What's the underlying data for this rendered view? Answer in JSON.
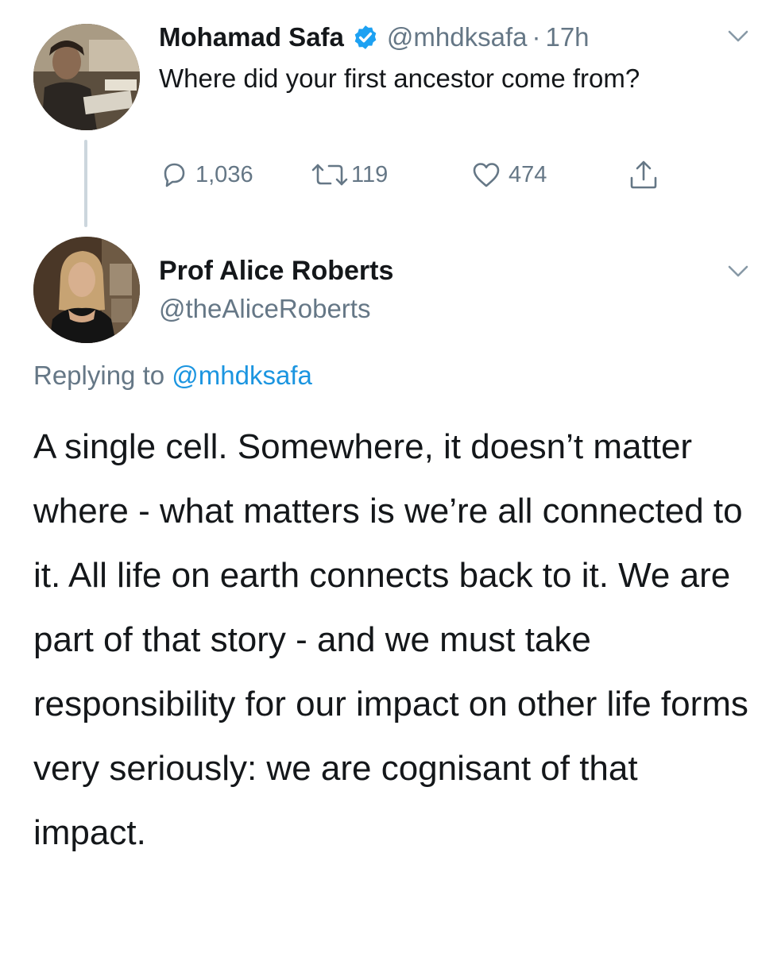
{
  "tweet1": {
    "display_name": "Mohamad Safa",
    "handle": "@mhdksafa",
    "separator": "·",
    "time": "17h",
    "verified_icon": "verified-badge-icon",
    "text": "Where did your first ancestor come from?",
    "actions": {
      "reply_count": "1,036",
      "retweet_count": "119",
      "like_count": "474"
    }
  },
  "tweet2": {
    "display_name": "Prof Alice Roberts",
    "handle": "@theAliceRoberts",
    "replying_prefix": "Replying to",
    "replying_to": "@mhdksafa",
    "text": "A single cell. Somewhere, it doesn’t matter where - what matters is we’re all connected to it. All life on earth connects back to it. We are part of that story - and we must take responsibility for our impact on other life forms very seriously: we are cognisant of that impact."
  },
  "colors": {
    "text_primary": "#14171a",
    "text_secondary": "#657786",
    "link": "#1b95e0",
    "verified": "#1da1f2",
    "thread_line": "#ccd6dd"
  },
  "icons": {
    "reply": "reply-icon",
    "retweet": "retweet-icon",
    "like": "heart-icon",
    "share": "share-icon",
    "caret": "chevron-down-icon"
  }
}
